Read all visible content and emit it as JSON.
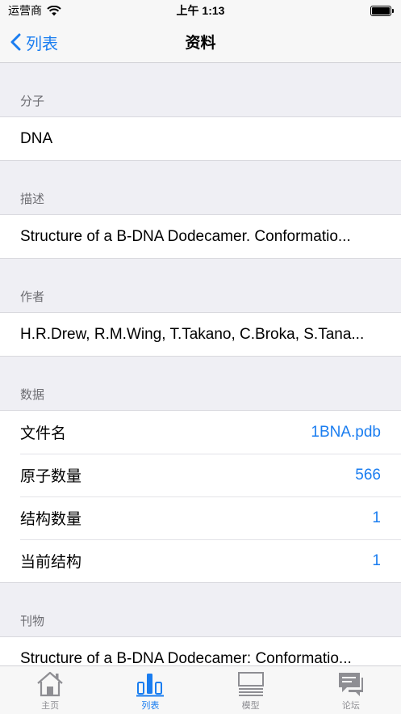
{
  "status": {
    "carrier": "运营商",
    "time": "上午 1:13"
  },
  "nav": {
    "back_label": "列表",
    "title": "资料"
  },
  "sections": [
    {
      "header": "分子",
      "rows": [
        {
          "label": "DNA"
        }
      ]
    },
    {
      "header": "描述",
      "rows": [
        {
          "label": "Structure of a B-DNA Dodecamer. Conformatio..."
        }
      ]
    },
    {
      "header": "作者",
      "rows": [
        {
          "label": "H.R.Drew, R.M.Wing, T.Takano, C.Broka, S.Tana..."
        }
      ]
    },
    {
      "header": "数据",
      "rows": [
        {
          "label": "文件名",
          "value": "1BNA.pdb"
        },
        {
          "label": "原子数量",
          "value": "566"
        },
        {
          "label": "结构数量",
          "value": "1"
        },
        {
          "label": "当前结构",
          "value": "1"
        }
      ]
    },
    {
      "header": "刊物",
      "rows": [
        {
          "label": "Structure of a B-DNA Dodecamer: Conformatio..."
        }
      ]
    }
  ],
  "tabs": [
    {
      "label": "主页",
      "icon": "home-icon"
    },
    {
      "label": "列表",
      "icon": "list-icon",
      "active": true
    },
    {
      "label": "模型",
      "icon": "model-icon"
    },
    {
      "label": "论坛",
      "icon": "forum-icon"
    }
  ],
  "colors": {
    "accent": "#1a7df0",
    "background": "#efeff4"
  }
}
